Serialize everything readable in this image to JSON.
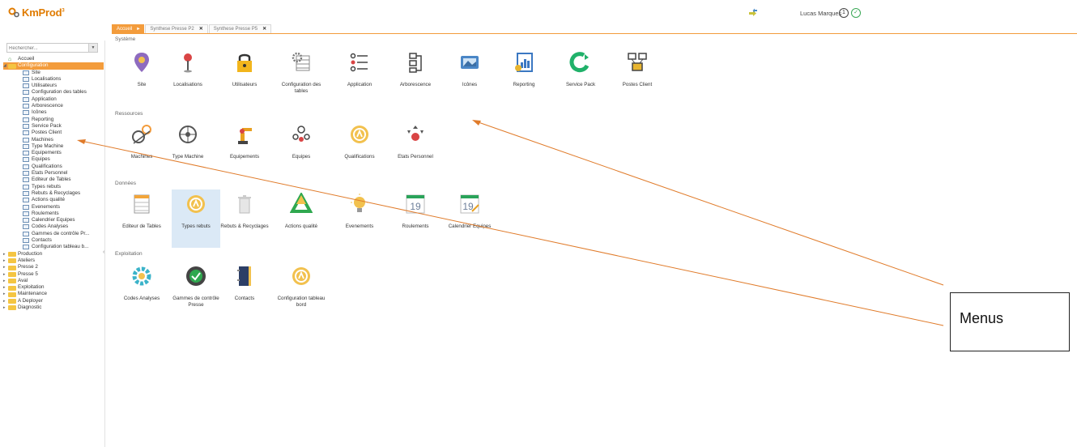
{
  "app": {
    "logo_text": "KmProd",
    "logo_sup": "3"
  },
  "header": {
    "user_name": "Lucas Marques"
  },
  "sidebar": {
    "search_placeholder": "Rechercher...",
    "tree": [
      {
        "label": "Accueil",
        "level": 0,
        "type": "home"
      },
      {
        "label": "Configuration",
        "level": 0,
        "type": "folder",
        "selected": true,
        "expanded": true
      },
      {
        "label": "Site",
        "level": 1
      },
      {
        "label": "Localisations",
        "level": 1
      },
      {
        "label": "Utilisateurs",
        "level": 1
      },
      {
        "label": "Configuration des tables",
        "level": 1
      },
      {
        "label": "Application",
        "level": 1
      },
      {
        "label": "Arborescence",
        "level": 1
      },
      {
        "label": "Icônes",
        "level": 1
      },
      {
        "label": "Reporting",
        "level": 1
      },
      {
        "label": "Service Pack",
        "level": 1
      },
      {
        "label": "Postes Client",
        "level": 1
      },
      {
        "label": "Machines",
        "level": 1
      },
      {
        "label": "Type Machine",
        "level": 1
      },
      {
        "label": "Equipements",
        "level": 1
      },
      {
        "label": "Equipes",
        "level": 1
      },
      {
        "label": "Qualifications",
        "level": 1
      },
      {
        "label": "Etats Personnel",
        "level": 1
      },
      {
        "label": "Editeur de Tables",
        "level": 1
      },
      {
        "label": "Types rebuts",
        "level": 1
      },
      {
        "label": "Rebuts & Recyclages",
        "level": 1
      },
      {
        "label": "Actions qualité",
        "level": 1
      },
      {
        "label": "Evenements",
        "level": 1
      },
      {
        "label": "Roulements",
        "level": 1
      },
      {
        "label": "Calendrier Equipes",
        "level": 1
      },
      {
        "label": "Codes Analyses",
        "level": 1
      },
      {
        "label": "Gammes de contrôle Pr...",
        "level": 1
      },
      {
        "label": "Contacts",
        "level": 1
      },
      {
        "label": "Configuration tableau b...",
        "level": 1
      },
      {
        "label": "Production",
        "level": 0,
        "type": "folder"
      },
      {
        "label": "Ateliers",
        "level": 0,
        "type": "folder"
      },
      {
        "label": "Presse 2",
        "level": 0,
        "type": "folder"
      },
      {
        "label": "Presse 5",
        "level": 0,
        "type": "folder"
      },
      {
        "label": "Aval",
        "level": 0,
        "type": "folder"
      },
      {
        "label": "Exploitation",
        "level": 0,
        "type": "folder"
      },
      {
        "label": "Maintenance",
        "level": 0,
        "type": "folder"
      },
      {
        "label": "A Deployer",
        "level": 0,
        "type": "folder"
      },
      {
        "label": "Diagnostic",
        "level": 0,
        "type": "folder"
      }
    ]
  },
  "tabs": [
    {
      "label": "Accueil",
      "active": true
    },
    {
      "label": "Synthese Presse P2",
      "active": false
    },
    {
      "label": "Synthese Presse P5",
      "active": false
    }
  ],
  "sections": {
    "systeme": {
      "title": "Système",
      "items": [
        {
          "label": "Site",
          "icon": "map-pin-icon"
        },
        {
          "label": "Localisations",
          "icon": "location-pin-icon"
        },
        {
          "label": "Utilisateurs",
          "icon": "lock-icon"
        },
        {
          "label": "Configuration des tables",
          "icon": "table-gear-icon"
        },
        {
          "label": "Application",
          "icon": "list-icon"
        },
        {
          "label": "Arborescence",
          "icon": "tree-icon"
        },
        {
          "label": "Icônes",
          "icon": "image-icon"
        },
        {
          "label": "Reporting",
          "icon": "report-icon"
        },
        {
          "label": "Service Pack",
          "icon": "update-icon"
        },
        {
          "label": "Postes Client",
          "icon": "network-icon"
        }
      ]
    },
    "ressources": {
      "title": "Ressources",
      "items": [
        {
          "label": "Machines",
          "icon": "machine-gear-icon"
        },
        {
          "label": "Type Machine",
          "icon": "wheel-icon"
        },
        {
          "label": "Equipements",
          "icon": "robot-arm-icon"
        },
        {
          "label": "Equipes",
          "icon": "team-icon"
        },
        {
          "label": "Qualifications",
          "icon": "badge-icon"
        },
        {
          "label": "Etats Personnel",
          "icon": "person-arrows-icon"
        }
      ]
    },
    "donnees": {
      "title": "Données",
      "items": [
        {
          "label": "Editeur de Tables",
          "icon": "table-edit-icon"
        },
        {
          "label": "Types rebuts",
          "icon": "badge-icon",
          "highlight": true
        },
        {
          "label": "Rebuts & Recyclages",
          "icon": "trash-icon"
        },
        {
          "label": "Actions qualité",
          "icon": "recycle-icon"
        },
        {
          "label": "Evenements",
          "icon": "lightbulb-icon"
        },
        {
          "label": "Roulements",
          "icon": "calendar-icon",
          "day": "19"
        },
        {
          "label": "Calendrier Equipes",
          "icon": "calendar-edit-icon",
          "day": "19"
        }
      ]
    },
    "exploitation": {
      "title": "Exploitation",
      "items": [
        {
          "label": "Codes Analyses",
          "icon": "puzzle-gear-icon"
        },
        {
          "label": "Gammes de contrôle Presse",
          "icon": "check-gear-icon"
        },
        {
          "label": "Contacts",
          "icon": "address-book-icon"
        },
        {
          "label": "Configuration tableau bord",
          "icon": "badge-icon"
        }
      ]
    }
  },
  "annotation": {
    "label": "Menus",
    "line_color": "#e07b2a"
  }
}
